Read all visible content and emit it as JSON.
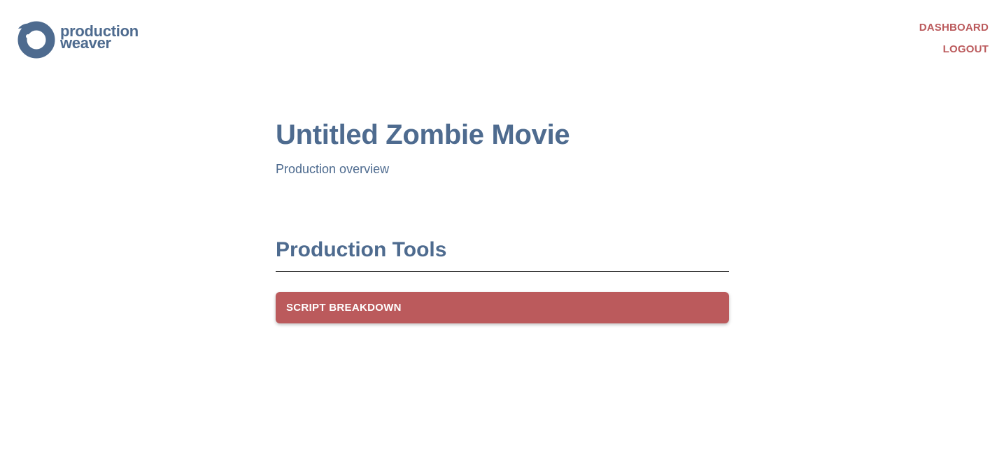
{
  "brand": {
    "line1": "production",
    "line2": "weaver",
    "color": "#4e6b8f"
  },
  "nav": {
    "dashboard": "DASHBOARD",
    "logout": "LOGOUT",
    "color": "#bb5a5c"
  },
  "main": {
    "title": "Untitled Zombie Movie",
    "subtitle": "Production overview",
    "tools_heading": "Production Tools",
    "tools": [
      {
        "label": "SCRIPT BREAKDOWN"
      }
    ]
  },
  "colors": {
    "primary_text": "#4e6b8f",
    "accent": "#bb5a5c",
    "background": "#ffffff"
  }
}
